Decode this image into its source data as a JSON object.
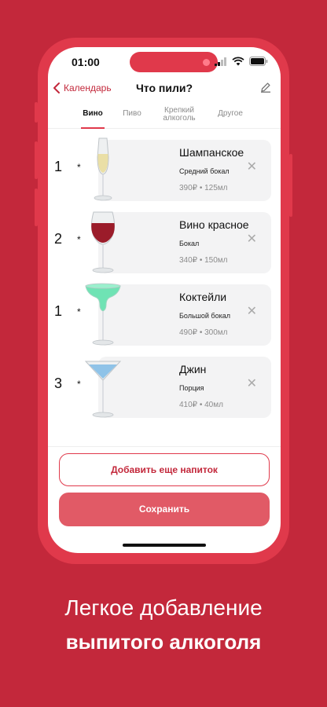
{
  "status": {
    "time": "01:00"
  },
  "nav": {
    "back_label": "Календарь",
    "title": "Что пили?"
  },
  "tabs": [
    {
      "label": "Вино",
      "active": true
    },
    {
      "label": "Пиво",
      "active": false
    },
    {
      "label": "Крепкий алкоголь",
      "active": false
    },
    {
      "label": "Другое",
      "active": false
    }
  ],
  "drinks": [
    {
      "qty": "1",
      "multiplier": "*",
      "name": "Шампанское",
      "size": "Средний бокал",
      "price": "390₽ • 125мл",
      "glass_icon": "champagne-flute-icon"
    },
    {
      "qty": "2",
      "multiplier": "*",
      "name": "Вино красное",
      "size": "Бокал",
      "price": "340₽ • 150мл",
      "glass_icon": "wine-glass-icon"
    },
    {
      "qty": "1",
      "multiplier": "*",
      "name": "Коктейли",
      "size": "Большой бокал",
      "price": "490₽ • 300мл",
      "glass_icon": "margarita-glass-icon"
    },
    {
      "qty": "3",
      "multiplier": "*",
      "name": "Джин",
      "size": "Порция",
      "price": "410₽ • 40мл",
      "glass_icon": "martini-glass-icon"
    }
  ],
  "actions": {
    "add_label": "Добавить еще напиток",
    "save_label": "Сохранить"
  },
  "caption": {
    "line1": "Легкое добавление",
    "line2": "выпитого алкоголя"
  },
  "colors": {
    "brand": "#c3283b",
    "accent": "#e0394b",
    "save": "#e15a66"
  }
}
